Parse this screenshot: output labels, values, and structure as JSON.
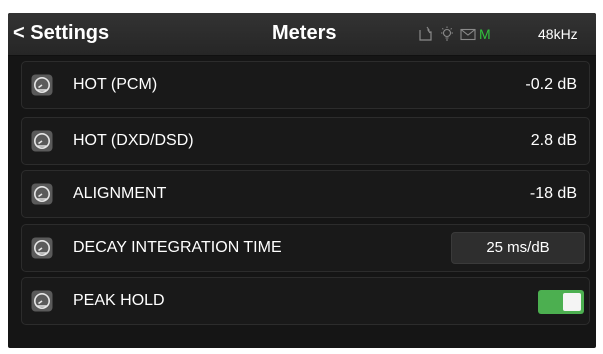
{
  "header": {
    "back_label": "< Settings",
    "title": "Meters",
    "status_icons": [
      "sd-card-icon",
      "light-icon",
      "mail-icon"
    ],
    "status_mode": "M",
    "status_mode_color": "#31c13d",
    "sample_rate": "48kHz"
  },
  "rows": [
    {
      "icon": "meter-icon",
      "label": "HOT (PCM)",
      "value": "-0.2 dB"
    },
    {
      "icon": "meter-icon",
      "label": "HOT (DXD/DSD)",
      "value": "2.8 dB"
    },
    {
      "icon": "meter-icon",
      "label": "ALIGNMENT",
      "value": "-18 dB"
    },
    {
      "icon": "meter-icon",
      "label": "DECAY INTEGRATION TIME",
      "value": "25 ms/dB"
    },
    {
      "icon": "meter-icon",
      "label": "PEAK HOLD",
      "toggle_on": true
    }
  ],
  "colors": {
    "background": "#151515",
    "row_background": "#191919",
    "toggle_on": "#4caf50"
  }
}
